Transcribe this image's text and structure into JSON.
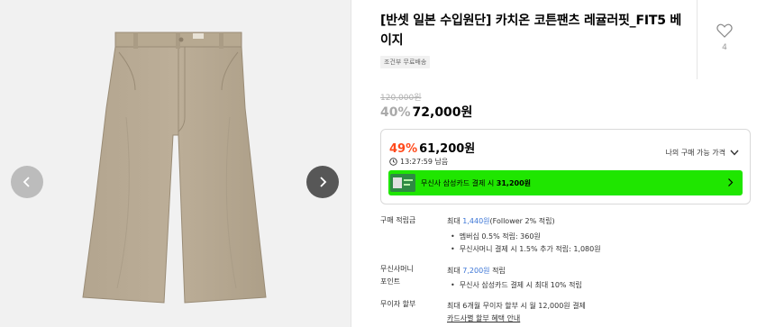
{
  "product": {
    "title": "[반셋 일본 수입원단] 카치온 코튼팬츠 레귤러핏_FIT5 베이지",
    "shipping_badge": "조건부 무료배송",
    "like_count": "4",
    "original_price": "120,000원",
    "discount_percent": "40%",
    "sale_price": "72,000원"
  },
  "benefit": {
    "discount_percent": "49%",
    "price": "61,200원",
    "timer": "13:27:59 남음",
    "my_price_label": "나의 구매 가능 가격"
  },
  "card_banner": {
    "text": "무신사 삼성카드 결제 시",
    "price": "31,200원"
  },
  "points": {
    "label": "구매 적립금",
    "main_prefix": "최대 ",
    "main_value": "1,440원",
    "main_suffix": "(Follower 2% 적립)",
    "bullets": [
      "멤버십 0.5% 적립: 360원",
      "무신사머니 결제 시 1.5% 추가 적립: 1,080원"
    ]
  },
  "money_point": {
    "label_line1": "무신사머니",
    "label_line2": "포인트",
    "main_prefix": "최대 ",
    "main_value": "7,200원",
    "main_suffix": " 적립",
    "bullet": "무신사 삼성카드 결제 시 최대 10% 적립"
  },
  "installment": {
    "label": "무이자 할부",
    "main": "최대 6개월 무이자 할부 시 월 12,000원 결제",
    "link": "카드사별 할부 혜택 안내"
  },
  "icons": {
    "prev": "chevron-left-icon",
    "next": "chevron-right-icon",
    "like": "heart-icon",
    "timer": "clock-icon",
    "dropdown": "chevron-down-icon",
    "banner_arrow": "chevron-right-icon"
  },
  "colors": {
    "accent_discount": "#ff4a1c",
    "banner_green": "#1fe600",
    "link_blue": "#3b75d6"
  }
}
